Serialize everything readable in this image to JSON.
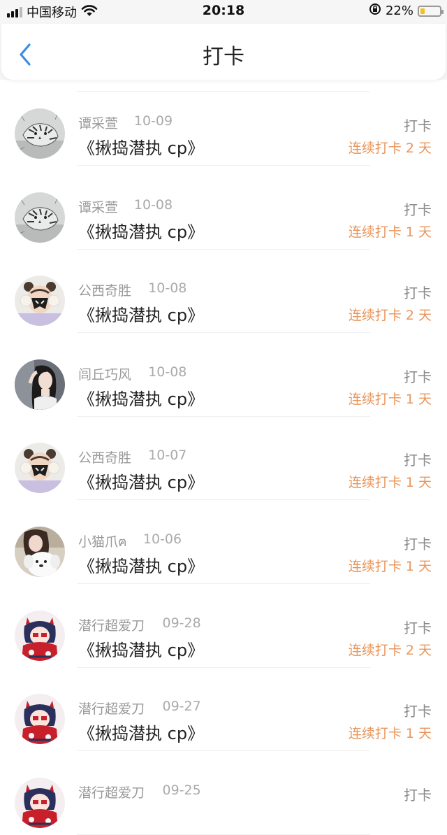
{
  "status_bar": {
    "carrier": "中国移动",
    "time": "20:18",
    "battery": "22%",
    "battery_level": 0.22,
    "icons": [
      "signal-icon",
      "wifi-icon",
      "rotation-lock-icon",
      "battery-icon"
    ]
  },
  "nav": {
    "back_icon": "chevron-left-icon",
    "title": "打卡"
  },
  "colors": {
    "accent": "#e8955a",
    "back": "#3a8ee6",
    "battery": "#f2c21b"
  },
  "rows": [
    {
      "name": "谭采萱",
      "date": "10-09",
      "title": "《揪捣潜执 cp》",
      "action": "打卡",
      "streak": "连续打卡 2 天",
      "avatar": "tiger"
    },
    {
      "name": "谭采萱",
      "date": "10-08",
      "title": "《揪捣潜执 cp》",
      "action": "打卡",
      "streak": "连续打卡 1 天",
      "avatar": "tiger"
    },
    {
      "name": "公西奇胜",
      "date": "10-08",
      "title": "《揪捣潜执 cp》",
      "action": "打卡",
      "streak": "连续打卡 2 天",
      "avatar": "mask"
    },
    {
      "name": "闾丘巧风",
      "date": "10-08",
      "title": "《揪捣潜执 cp》",
      "action": "打卡",
      "streak": "连续打卡 1 天",
      "avatar": "girl"
    },
    {
      "name": "公西奇胜",
      "date": "10-07",
      "title": "《揪捣潜执 cp》",
      "action": "打卡",
      "streak": "连续打卡 1 天",
      "avatar": "mask"
    },
    {
      "name": "小猫爪ฅ",
      "date": "10-06",
      "title": "《揪捣潜执 cp》",
      "action": "打卡",
      "streak": "连续打卡 1 天",
      "avatar": "dog"
    },
    {
      "name": "潜行超爱刀",
      "date": "09-28",
      "title": "《揪捣潜执 cp》",
      "action": "打卡",
      "streak": "连续打卡 2 天",
      "avatar": "anime"
    },
    {
      "name": "潜行超爱刀",
      "date": "09-27",
      "title": "《揪捣潜执 cp》",
      "action": "打卡",
      "streak": "连续打卡 1 天",
      "avatar": "anime"
    },
    {
      "name": "潜行超爱刀",
      "date": "09-25",
      "title": "",
      "action": "打卡",
      "streak": "",
      "avatar": "anime"
    }
  ]
}
